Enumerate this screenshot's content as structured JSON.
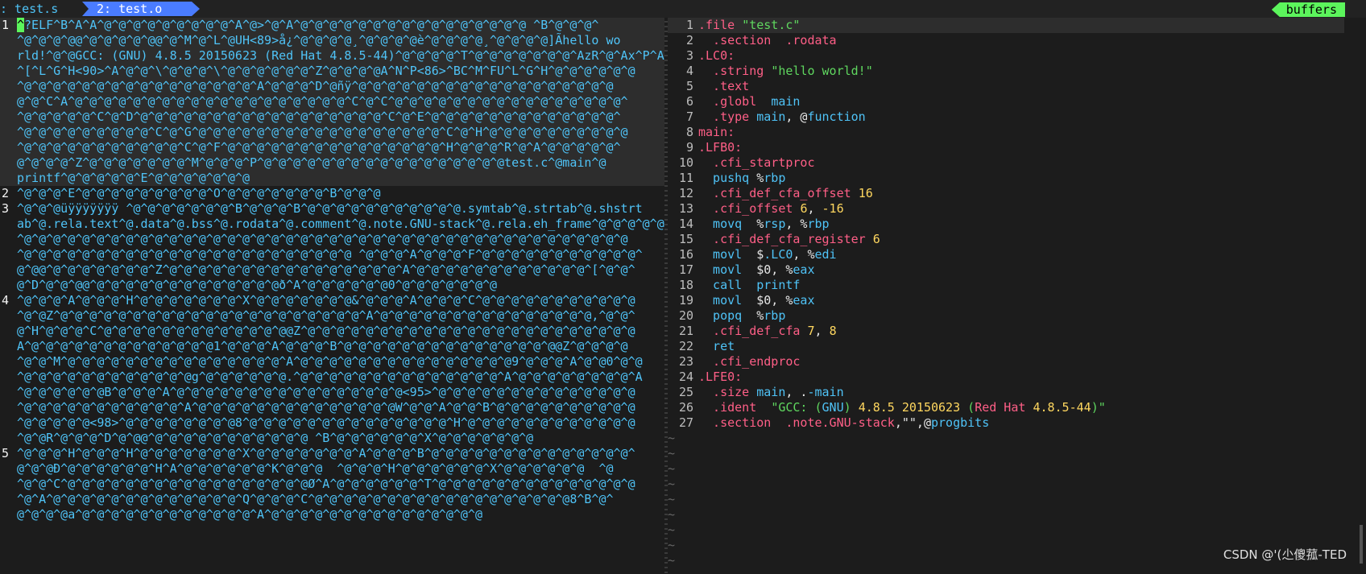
{
  "tabline": {
    "tab1": ": test.s",
    "tab2": "2: test.o",
    "buffers": "buffers"
  },
  "left": {
    "lines": [
      {
        "n": "1",
        "t": "^?ELF^B^A^A^@^@^@^@^@^@^@^@^@^A^@>^@^A^@^@^@^@^@^@^@^@^@^@^@^@^@^@^@^@ ^B^@^@^@^",
        "cursor": true,
        "hl": true
      },
      {
        "n": "",
        "t": "^@^@^@^@@^@^@^@^@^@@^@^M^@^L^@UH<89>å¿^@^@^@^@¸^@^@^@^@è^@^@^@^@¸^@^@^@^@]Ãhello wo",
        "hl": true
      },
      {
        "n": "",
        "t": "rld!^@^@GCC: (GNU) 4.8.5 20150623 (Red Hat 4.8.5-44)^@^@^@^@^T^@^@^@^@^@^@^@^AzR^@^Ax^P^A",
        "hl": true
      },
      {
        "n": "",
        "t": "^[^L^G^H<90>^A^@^@^\\^@^@^@^\\^@^@^@^@^@^@^Z^@^@^@^@A^N^P<86>^BC^M^FU^L^G^H^@^@^@^@^@^@",
        "hl": true
      },
      {
        "n": "",
        "t": "^@^@^@^@^@^@^@^@^@^@^@^@^@^@^@^@^A^@^@^@^D^@ñÿ^@^@^@^@^@^@^@^@^@^@^@^@^@^@^@^@^@^@",
        "hl": true
      },
      {
        "n": "",
        "t": "@^@^C^A^@^@^@^@^@^@^@^@^@^@^@^@^@^@^@^@^@^@^@^C^@^C^@^@^@^@^@^@^@^@^@^@^@^@^@^@^@^@^",
        "hl": true
      },
      {
        "n": "",
        "t": "^@^@^@^@^@^C^@^D^@^@^@^@^@^@^@^@^@^@^@^@^@^@^@^@^@^C^@^E^@^@^@^@^@^@^@^@^@^@^@^@^@^",
        "hl": true
      },
      {
        "n": "",
        "t": "^@^@^@^@^@^@^@^@^@^C^@^G^@^@^@^@^@^@^@^@^@^@^@^@^@^@^@^@^@^C^@^H^@^@^@^@^@^@^@^@^@^@",
        "hl": true
      },
      {
        "n": "",
        "t": "^@^@^@^@^@^@^@^@^@^@^@^C^@^F^@^@^@^@^@^@^@^@^@^@^@^@^@^@^@^H^@^@^@^R^@^A^@^@^@^@^@^",
        "hl": true
      },
      {
        "n": "",
        "t": "@^@^@^@^Z^@^@^@^@^@^@^@^M^@^@^@^P^@^@^@^@^@^@^@^@^@^@^@^@^@^@^@^@^@test.c^@main^@",
        "hl": true
      },
      {
        "n": "",
        "t": "printf^@^@^@^@^@^E^@^@^@^@^@^@^@",
        "hl": true
      },
      {
        "n": "2",
        "t": "^@^@^@^E^@^@^@^@^@^@^@^@^@^O^@^@^@^@^@^@^@^B^@^@^@"
      },
      {
        "n": "3",
        "t": "^@^@^@üÿÿÿÿÿÿÿ ^@^@^@^@^@^@^@^B^@^@^@^B^@^@^@^@^@^@^@^@^@^@^@.symtab^@.strtab^@.shstrt"
      },
      {
        "n": "",
        "t": "ab^@.rela.text^@.data^@.bss^@.rodata^@.comment^@.note.GNU-stack^@.rela.eh_frame^@^@^@^@^@"
      },
      {
        "n": "",
        "t": "^@^@^@^@^@^@^@^@^@^@^@^@^@^@^@^@^@^@^@^@^@^@^@^@^@^@^@^@^@^@^@^@^@^@^@^@^@^@^@^@^@^@"
      },
      {
        "n": "",
        "t": "^@^@^@^@^@^@^@^@^@^@^@^@^@^@^@^@^@^@^@^@^@^@^@ ^@^@^@^A^@^@^@^F^@^@^@^@^@^@^@^@^@^@^@^"
      },
      {
        "n": "",
        "t": "@^@@^@^@^@^@^@^@^@^Z^@^@^@^@^@^@^@^@^@^@^@^@^@^@^@^@^A^@^@^@^@^@^@^@^@^@^@^@^@^[^@^@^"
      },
      {
        "n": "",
        "t": "@^D^@^@^@@^@^@^@^@^@^@^@^@^@^@^@^@^@ð^A^@^@^@^@^@^@0^@^@^@^@^@^@^@"
      },
      {
        "n": "4",
        "t": "^@^@^@^A^@^@^@^H^@^@^@^@^@^@^@^X^@^@^@^@^@^@^@&^@^@^@^A^@^@^@^C^@^@^@^@^@^@^@^@^@^@^@"
      },
      {
        "n": "",
        "t": "^@^@Z^@^@^@^@^@^@^@^@^@^@^@^@^@^@^@^@^@^@^@^@^@^A^@^@^@^@^@^@^@^@^@^@^@^@^@^@^@,^@^@^"
      },
      {
        "n": "",
        "t": "@^H^@^@^@^C^@^@^@^@^@^@^@^@^@^@^@^@^@@Z^@^@^@^@^@^@^@^@^@^@^@^@^@^@^@^@^@^@^@^@^@^@^@"
      },
      {
        "n": "",
        "t": "A^@^@^@^@^@^@^@^@^@^@^@^@^@1^@^@^@^A^@^@^@^B^@^@^@^@^@^@^@^@^@^@^@^@^@^@^@@Z^@^@^@^@"
      },
      {
        "n": "",
        "t": "^@^@^M^@^@^@^@^@^@^@^@^@^@^@^@^@^@^@^A^@^@^@^@^@^@^@^@^@^@^@^@^@^@^@9^@^@^@^A^@^@0^@^@"
      },
      {
        "n": "",
        "t": "^@^@^@^@^@^@^@^@^@^@^@^@g^@^@^@^@^@^@.^@^@^@^@^@^@^@^@^@^@^@^@^@^@^A^@^@^@^@^@^@^@^@^A"
      },
      {
        "n": "",
        "t": "^@^@^@^@^@^@B^@^@^@^A^@^@^@^@^@^@^@^@^@^@^@^@^@^@^@^@<95>^@^@^@^@^@^@^@^@^@^@^@^@^@^@"
      },
      {
        "n": "",
        "t": "^@^@^@^@^@^@^@^@^@^@^@^A^@^@^@^@^@^@^@^@^@^@^@^@^@^@W^@^@^A^@^@^B^@^@^@^@^@^@^@^@^@^@"
      },
      {
        "n": "",
        "t": "^@^@^@^@^@<98>^@^@^@^@^@^@^@^@8^@^@^@^@^@^@^@^@^@^@^@^@^@^@^H^@^@^@^@^@^@^@^@^@^@^@^@"
      },
      {
        "n": "",
        "t": "^@^@R^@^@^@^D^@^@@^@^@^@^@^@^@^@^@^@^@^@ ^B^@^@^@^@^@^@^X^@^@^@^@^@^@^@"
      },
      {
        "n": "5",
        "t": "^@^@^@^H^@^@^@^H^@^@^@^@^@^@^@^X^@^@^@^@^@^@^@^A^@^@^@^B^@^@^@^@^@^@^@^@^@^@^@^@^@^@^"
      },
      {
        "n": "",
        "t": "@^@^@Ð^@^@^@^@^@^@^H^A^@^@^@^@^@^@^K^@^@^@  ^@^@^@^H^@^@^@^@^@^@^X^@^@^@^@^@^@  ^@"
      },
      {
        "n": "",
        "t": "^@^@^C^@^@^@^@^@^@^@^@^@^@^@^@^@^@^@^@^@Ø^A^@^@^@^@^@^@^T^@^@^@^@^@^@^@^@^@^@^@^@^@^@"
      },
      {
        "n": "",
        "t": "^@^A^@^@^@^@^@^@^@^@^@^@^@^@^@^Q^@^@^@^C^@^@^@^@^@^@^@^@^@^@^@^@^@^@^@^@^@^@8^B^@^"
      },
      {
        "n": "",
        "t": "@^@^@^@a^@^@^@^@^@^@^@^@^@^@^@^@^A^@^@^@^@^@^@^@^@^@^@^@^@^@^@^@"
      }
    ]
  },
  "right": {
    "lines": [
      {
        "n": "1",
        "parts": [
          [
            "kw",
            ".file "
          ],
          [
            "str",
            "\"test.c\""
          ]
        ]
      },
      {
        "n": "2",
        "parts": [
          [
            "kw",
            "  .section  .rodata"
          ]
        ]
      },
      {
        "n": "3",
        "parts": [
          [
            "lbl",
            ".LC0:"
          ]
        ]
      },
      {
        "n": "4",
        "parts": [
          [
            "kw",
            "  .string "
          ],
          [
            "str",
            "\"hello world!\""
          ]
        ]
      },
      {
        "n": "5",
        "parts": [
          [
            "kw",
            "  .text"
          ]
        ]
      },
      {
        "n": "6",
        "parts": [
          [
            "kw",
            "  .globl  "
          ],
          [
            "teal",
            "main"
          ]
        ]
      },
      {
        "n": "7",
        "parts": [
          [
            "kw",
            "  .type "
          ],
          [
            "teal",
            "main"
          ],
          [
            "plain",
            ", @"
          ],
          [
            "teal",
            "function"
          ]
        ]
      },
      {
        "n": "8",
        "parts": [
          [
            "lbl",
            "main:"
          ]
        ]
      },
      {
        "n": "9",
        "parts": [
          [
            "lbl",
            ".LFB0:"
          ]
        ]
      },
      {
        "n": "10",
        "parts": [
          [
            "kw",
            "  .cfi_startproc"
          ]
        ]
      },
      {
        "n": "11",
        "parts": [
          [
            "teal",
            "  pushq "
          ],
          [
            "plain",
            "%"
          ],
          [
            "teal",
            "rbp"
          ]
        ]
      },
      {
        "n": "12",
        "parts": [
          [
            "kw",
            "  .cfi_def_cfa_offset "
          ],
          [
            "num",
            "16"
          ]
        ]
      },
      {
        "n": "13",
        "parts": [
          [
            "kw",
            "  .cfi_offset "
          ],
          [
            "num",
            "6"
          ],
          [
            "plain",
            ", "
          ],
          [
            "num",
            "-16"
          ]
        ]
      },
      {
        "n": "14",
        "parts": [
          [
            "teal",
            "  movq  "
          ],
          [
            "plain",
            "%"
          ],
          [
            "teal",
            "rsp"
          ],
          [
            "plain",
            ", %"
          ],
          [
            "teal",
            "rbp"
          ]
        ]
      },
      {
        "n": "15",
        "parts": [
          [
            "kw",
            "  .cfi_def_cfa_register "
          ],
          [
            "num",
            "6"
          ]
        ]
      },
      {
        "n": "16",
        "parts": [
          [
            "teal",
            "  movl  "
          ],
          [
            "plain",
            "$"
          ],
          [
            "teal",
            ".LC0"
          ],
          [
            "plain",
            ", %"
          ],
          [
            "teal",
            "edi"
          ]
        ]
      },
      {
        "n": "17",
        "parts": [
          [
            "teal",
            "  movl  "
          ],
          [
            "plain",
            "$0, %"
          ],
          [
            "teal",
            "eax"
          ]
        ]
      },
      {
        "n": "18",
        "parts": [
          [
            "teal",
            "  call  printf"
          ]
        ]
      },
      {
        "n": "19",
        "parts": [
          [
            "teal",
            "  movl  "
          ],
          [
            "plain",
            "$0, %"
          ],
          [
            "teal",
            "eax"
          ]
        ]
      },
      {
        "n": "20",
        "parts": [
          [
            "teal",
            "  popq  "
          ],
          [
            "plain",
            "%"
          ],
          [
            "teal",
            "rbp"
          ]
        ]
      },
      {
        "n": "21",
        "parts": [
          [
            "kw",
            "  .cfi_def_cfa "
          ],
          [
            "num",
            "7"
          ],
          [
            "plain",
            ", "
          ],
          [
            "num",
            "8"
          ]
        ]
      },
      {
        "n": "22",
        "parts": [
          [
            "teal",
            "  ret"
          ]
        ]
      },
      {
        "n": "23",
        "parts": [
          [
            "kw",
            "  .cfi_endproc"
          ]
        ]
      },
      {
        "n": "24",
        "parts": [
          [
            "lbl",
            ".LFE0:"
          ]
        ]
      },
      {
        "n": "25",
        "parts": [
          [
            "kw",
            "  .size "
          ],
          [
            "teal",
            "main"
          ],
          [
            "plain",
            ", ."
          ],
          [
            "teal",
            "-main"
          ]
        ]
      },
      {
        "n": "26",
        "parts": [
          [
            "kw",
            "  .ident  "
          ],
          [
            "str",
            "\"GCC: ("
          ],
          [
            "teal",
            "GNU"
          ],
          [
            "str",
            ") "
          ],
          [
            "num",
            "4.8.5 20150623"
          ],
          [
            "str",
            " ("
          ],
          [
            "red",
            "Red Hat"
          ],
          [
            "str",
            " "
          ],
          [
            "num",
            "4.8.5-44"
          ],
          [
            "str",
            ")\""
          ]
        ]
      },
      {
        "n": "27",
        "parts": [
          [
            "kw",
            "  .section  .note.GNU-stack"
          ],
          [
            "plain",
            ",\"\",@"
          ],
          [
            "teal",
            "progbits"
          ]
        ]
      }
    ],
    "tilde_count": 10
  },
  "watermark": "CSDN @'(尐傻菰-TED",
  "colors": {
    "background": "#1c1c1c",
    "text_cyan": "#4fc3f7",
    "keyword_pink": "#ff5f87",
    "string_green": "#5fd75f",
    "number_yellow": "#ffd75f",
    "tab_active": "#4a7cff",
    "buffers_tag": "#5cf55c"
  }
}
